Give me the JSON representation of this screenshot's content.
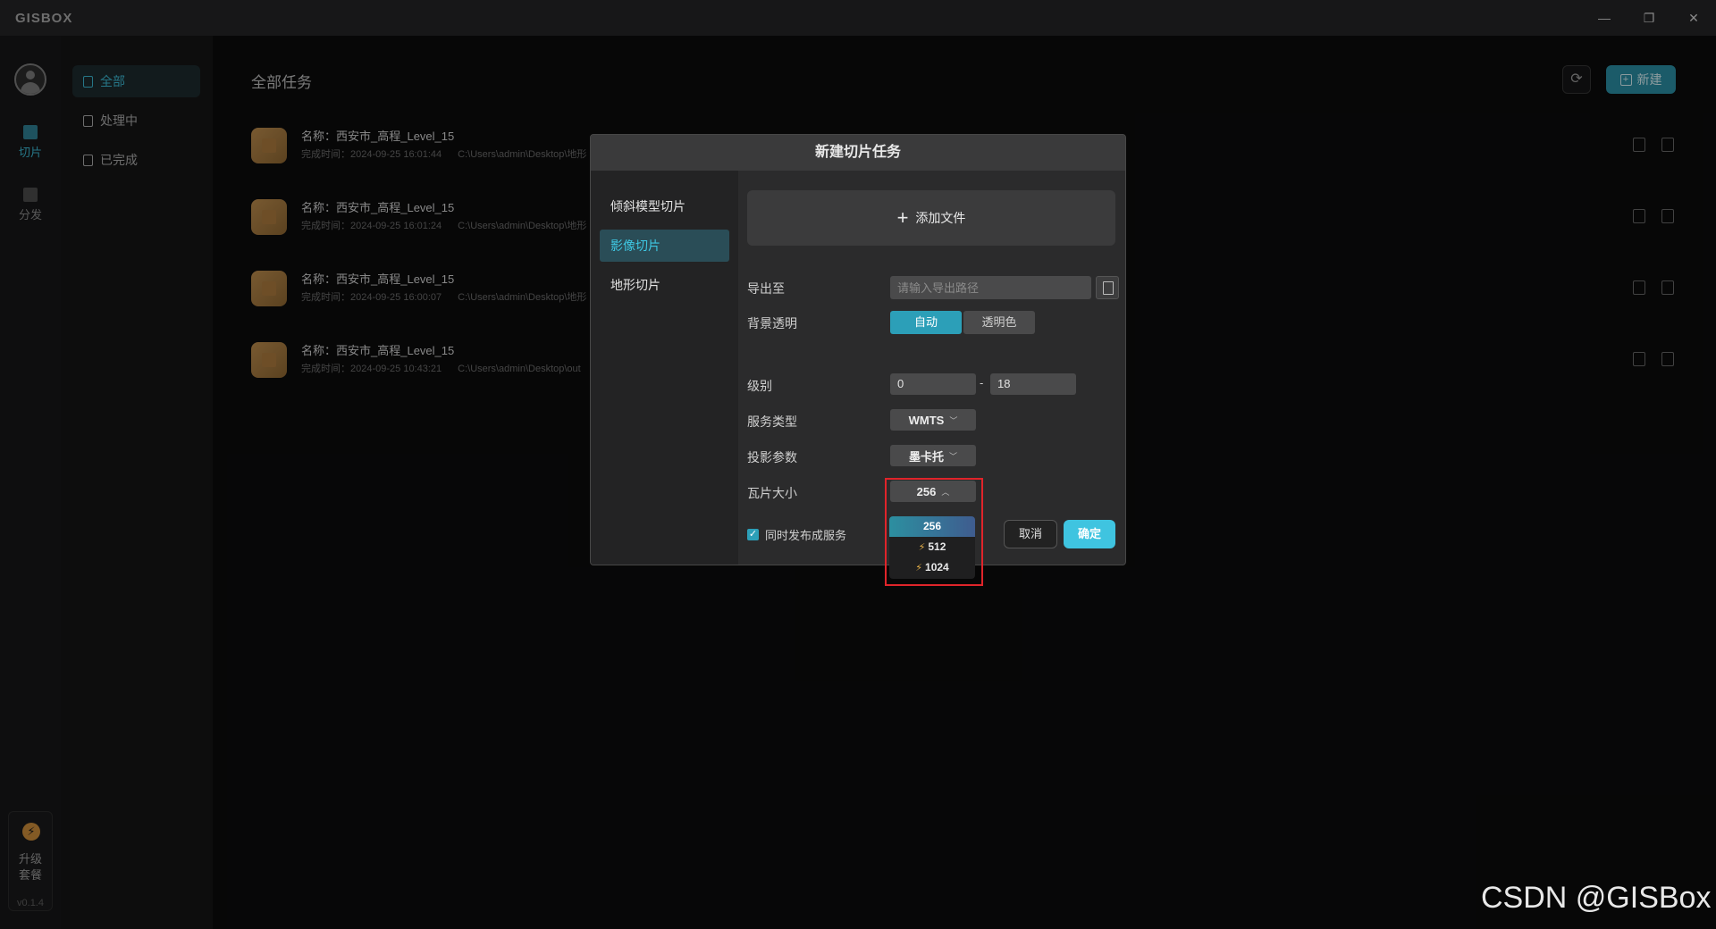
{
  "app": {
    "logo": "GISBOX",
    "window_controls": [
      "—",
      "❐",
      "✕"
    ]
  },
  "rail": {
    "items": [
      {
        "label": "切片",
        "icon": "slice-icon",
        "active": true
      },
      {
        "label": "分发",
        "icon": "distribute-icon",
        "active": false
      }
    ],
    "upgrade": {
      "line1": "升级",
      "line2": "套餐",
      "badge": "⚡"
    },
    "version": "v0.1.4"
  },
  "sidebar": {
    "items": [
      {
        "label": "全部",
        "active": true
      },
      {
        "label": "处理中",
        "active": false
      },
      {
        "label": "已完成",
        "active": false
      }
    ]
  },
  "main": {
    "title": "全部任务",
    "refresh": "⟳",
    "new_button": "新建",
    "tasks": [
      {
        "name": "名称：西安市_高程_Level_15",
        "time": "完成时间：2024-09-25 16:01:44",
        "path": "C:\\Users\\admin\\Desktop\\地形"
      },
      {
        "name": "名称：西安市_高程_Level_15",
        "time": "完成时间：2024-09-25 16:01:24",
        "path": "C:\\Users\\admin\\Desktop\\地形"
      },
      {
        "name": "名称：西安市_高程_Level_15",
        "time": "完成时间：2024-09-25 16:00:07",
        "path": "C:\\Users\\admin\\Desktop\\地形"
      },
      {
        "name": "名称：西安市_高程_Level_15",
        "time": "完成时间：2024-09-25 10:43:21",
        "path": "C:\\Users\\admin\\Desktop\\out"
      }
    ]
  },
  "dialog": {
    "title": "新建切片任务",
    "nav": [
      {
        "label": "倾斜模型切片",
        "active": false
      },
      {
        "label": "影像切片",
        "active": true
      },
      {
        "label": "地形切片",
        "active": false
      }
    ],
    "add_file": "添加文件",
    "export": {
      "label": "导出至",
      "placeholder": "请输入导出路径",
      "value": ""
    },
    "background": {
      "label": "背景透明",
      "options": [
        "自动",
        "透明色"
      ],
      "selected": "自动"
    },
    "level": {
      "label": "级别",
      "min": "0",
      "separator": "-",
      "max": "18"
    },
    "service_type": {
      "label": "服务类型",
      "value": "WMTS"
    },
    "projection": {
      "label": "投影参数",
      "value": "墨卡托"
    },
    "tile_size": {
      "label": "瓦片大小",
      "value": "256",
      "options": [
        {
          "label": "256",
          "premium": false,
          "selected": true
        },
        {
          "label": "512",
          "premium": true,
          "selected": false
        },
        {
          "label": "1024",
          "premium": true,
          "selected": false
        }
      ]
    },
    "publish": {
      "label": "同时发布成服务",
      "checked": true
    },
    "cancel": "取消",
    "confirm": "确定"
  },
  "watermark": "CSDN @GISBox",
  "colors": {
    "accent": "#2c9fb8",
    "confirm": "#3fc4e0",
    "highlight_box": "#e0242a",
    "premium_bolt": "#e9b34a"
  }
}
